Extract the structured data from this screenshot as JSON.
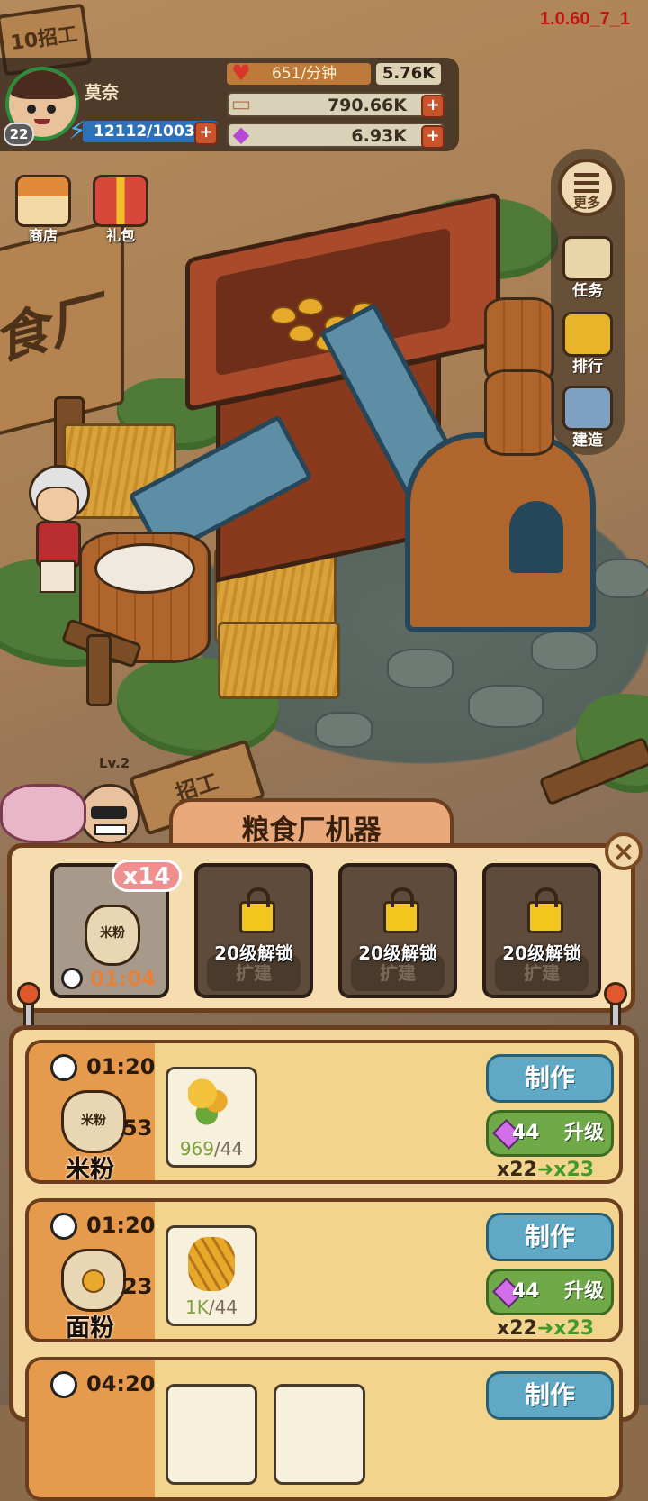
{
  "version": "1.0.60_7_1",
  "player": {
    "name": "莫奈",
    "level": "22",
    "energy": "12112/1003"
  },
  "resources": {
    "heart_rate": "651/分钟",
    "heart_total": "5.76K",
    "money": "790.66K",
    "gems": "6.93K"
  },
  "top_icons": [
    {
      "label": "商店",
      "icon": "shop-icon"
    },
    {
      "label": "礼包",
      "icon": "gift-icon"
    }
  ],
  "side_menu": {
    "more_label": "更多",
    "items": [
      {
        "label": "任务",
        "icon": "scroll-icon"
      },
      {
        "label": "排行",
        "icon": "trophy-icon"
      },
      {
        "label": "建造",
        "icon": "hammer-icon"
      }
    ]
  },
  "scene": {
    "factory_sign": "食厂",
    "recruit_sign_top": "10招工",
    "recruit_sign_bottom": "招工",
    "npc_level": "Lv.2"
  },
  "machine_panel": {
    "title": "粮食厂机器",
    "queue_count": "x14",
    "active_slot": {
      "product": "米粉",
      "timer": "01:04"
    },
    "locked_slots": [
      {
        "unlock_label": "20级解锁",
        "expand_label": "扩建"
      },
      {
        "unlock_label": "20级解锁",
        "expand_label": "扩建"
      },
      {
        "unlock_label": "20级解锁",
        "expand_label": "扩建"
      }
    ]
  },
  "recipes": [
    {
      "name": "米粉",
      "sack_text": "米\n粉",
      "time": "01:20",
      "count": "53",
      "ingredient_have": "969",
      "ingredient_need": "/44",
      "make_label": "制作",
      "upgrade_cost": "44",
      "upgrade_label": "升级",
      "mult_from": "x22",
      "mult_to": "x23"
    },
    {
      "name": "面粉",
      "sack_text": "",
      "time": "01:20",
      "count": "23",
      "ingredient_have": "1K",
      "ingredient_need": "/44",
      "make_label": "制作",
      "upgrade_cost": "44",
      "upgrade_label": "升级",
      "mult_from": "x22",
      "mult_to": "x23"
    },
    {
      "name": "",
      "time": "04:20",
      "make_label": "制作"
    }
  ],
  "colors": {
    "make_button": "#5fa8c6",
    "upgrade_button": "#6fa948",
    "version_text": "#c41414"
  }
}
